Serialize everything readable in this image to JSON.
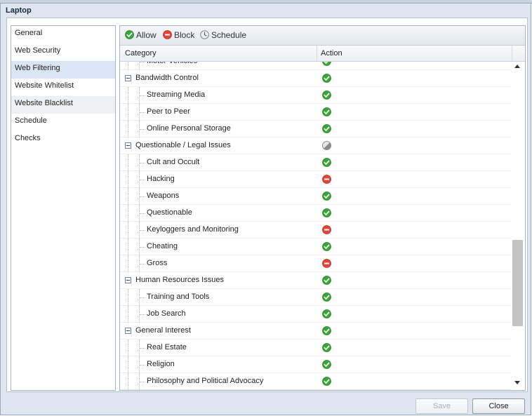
{
  "window": {
    "title": "Laptop"
  },
  "sidebar": {
    "items": [
      {
        "label": "General",
        "state": ""
      },
      {
        "label": "Web Security",
        "state": ""
      },
      {
        "label": "Web Filtering",
        "state": "active"
      },
      {
        "label": "Website Whitelist",
        "state": ""
      },
      {
        "label": "Website Blacklist",
        "state": "hover"
      },
      {
        "label": "Schedule",
        "state": ""
      },
      {
        "label": "Checks",
        "state": ""
      }
    ]
  },
  "toolbar": {
    "allow_label": "Allow",
    "block_label": "Block",
    "schedule_label": "Schedule"
  },
  "table": {
    "columns": [
      "Category",
      "Action"
    ],
    "rows": [
      {
        "label": "Motor Vehicles",
        "level": 1,
        "action": "allow"
      },
      {
        "label": "Bandwidth Control",
        "level": 0,
        "action": "allow"
      },
      {
        "label": "Streaming Media",
        "level": 1,
        "action": "allow"
      },
      {
        "label": "Peer to Peer",
        "level": 1,
        "action": "allow"
      },
      {
        "label": "Online Personal Storage",
        "level": 1,
        "action": "allow"
      },
      {
        "label": "Questionable / Legal Issues",
        "level": 0,
        "action": "mixed"
      },
      {
        "label": "Cult and Occult",
        "level": 1,
        "action": "allow"
      },
      {
        "label": "Hacking",
        "level": 1,
        "action": "block"
      },
      {
        "label": "Weapons",
        "level": 1,
        "action": "allow"
      },
      {
        "label": "Questionable",
        "level": 1,
        "action": "allow"
      },
      {
        "label": "Keyloggers and Monitoring",
        "level": 1,
        "action": "block"
      },
      {
        "label": "Cheating",
        "level": 1,
        "action": "allow"
      },
      {
        "label": "Gross",
        "level": 1,
        "action": "block"
      },
      {
        "label": "Human Resources Issues",
        "level": 0,
        "action": "allow"
      },
      {
        "label": "Training and Tools",
        "level": 1,
        "action": "allow"
      },
      {
        "label": "Job Search",
        "level": 1,
        "action": "allow"
      },
      {
        "label": "General Interest",
        "level": 0,
        "action": "allow"
      },
      {
        "label": "Real Estate",
        "level": 1,
        "action": "allow"
      },
      {
        "label": "Religion",
        "level": 1,
        "action": "allow"
      },
      {
        "label": "Philosophy and Political Advocacy",
        "level": 1,
        "action": "allow"
      }
    ]
  },
  "footer": {
    "save_label": "Save",
    "close_label": "Close"
  },
  "colors": {
    "allow": "#3aa53a",
    "block": "#e0453a",
    "mixed": "#9a9a9a",
    "active_nav": "#dbe6f4"
  },
  "icons": {
    "allow": "check-circle-icon",
    "block": "minus-circle-icon",
    "schedule": "clock-icon",
    "mixed": "half-circle-icon"
  }
}
